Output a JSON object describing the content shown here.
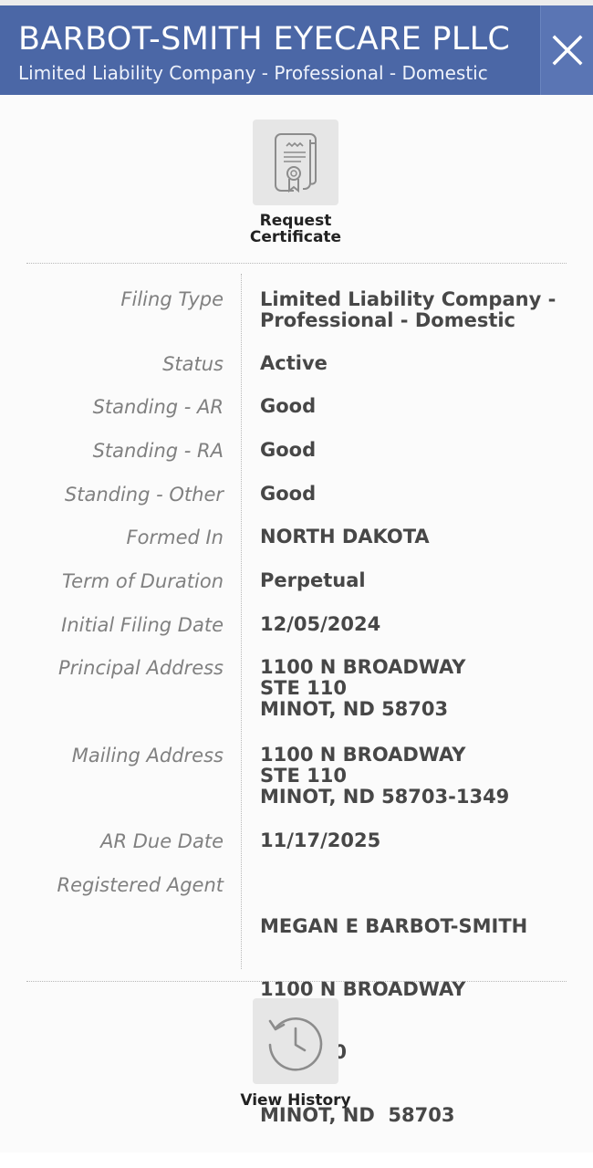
{
  "header": {
    "title": "BARBOT-SMITH EYECARE PLLC",
    "subtitle": "Limited Liability Company - Professional - Domestic"
  },
  "actions": {
    "request_certificate": {
      "line1": "Request",
      "line2": "Certificate",
      "icon": "certificate-scroll-icon"
    },
    "view_history": {
      "label": "View History",
      "icon": "history-clock-icon"
    }
  },
  "details": {
    "filing_type": {
      "label": "Filing Type",
      "lines": [
        "Limited Liability Company -",
        "Professional - Domestic"
      ]
    },
    "status": {
      "label": "Status",
      "value": "Active"
    },
    "standing_ar": {
      "label": "Standing - AR",
      "value": "Good"
    },
    "standing_ra": {
      "label": "Standing - RA",
      "value": "Good"
    },
    "standing_other": {
      "label": "Standing - Other",
      "value": "Good"
    },
    "formed_in": {
      "label": "Formed In",
      "value": "NORTH DAKOTA"
    },
    "term_of_duration": {
      "label": "Term of Duration",
      "value": "Perpetual"
    },
    "initial_filing_date": {
      "label": "Initial Filing Date",
      "value": "12/05/2024"
    },
    "principal_address": {
      "label": "Principal Address",
      "lines": [
        "1100 N BROADWAY",
        "STE 110",
        "MINOT, ND 58703"
      ]
    },
    "mailing_address": {
      "label": "Mailing Address",
      "lines": [
        "1100 N BROADWAY",
        "STE 110",
        "MINOT, ND 58703-1349"
      ]
    },
    "ar_due_date": {
      "label": "AR Due Date",
      "value": "11/17/2025"
    },
    "registered_agent": {
      "label": "Registered Agent",
      "lines": [
        "MEGAN E BARBOT-SMITH",
        "1100 N BROADWAY",
        "STE 110",
        "MINOT, ND  58703"
      ]
    }
  },
  "colors": {
    "header_bg": "#4b67a6",
    "label_text": "#808080",
    "value_text": "#474747"
  }
}
